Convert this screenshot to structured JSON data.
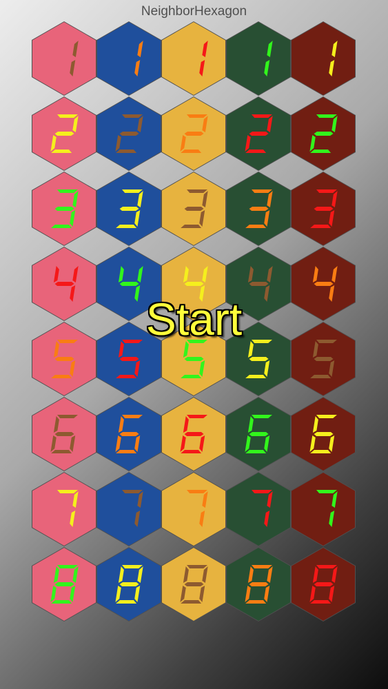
{
  "app": {
    "title": "NeighborHexagon"
  },
  "overlay": {
    "start_label": "Start"
  },
  "colors": {
    "hex_backgrounds": [
      "#e8647a",
      "#1f4f9c",
      "#e7b33f",
      "#284f33",
      "#711e12"
    ],
    "digit_palette": {
      "brown": "#8d5a30",
      "orange": "#f97d13",
      "red": "#f51818",
      "green": "#32f51c",
      "yellow": "#f5ef1d"
    }
  },
  "board": {
    "rows": [
      {
        "digit": "1",
        "cells": [
          {
            "digit_color": "brown"
          },
          {
            "digit_color": "orange"
          },
          {
            "digit_color": "red"
          },
          {
            "digit_color": "green"
          },
          {
            "digit_color": "yellow"
          }
        ]
      },
      {
        "digit": "2",
        "cells": [
          {
            "digit_color": "yellow"
          },
          {
            "digit_color": "brown"
          },
          {
            "digit_color": "orange"
          },
          {
            "digit_color": "red"
          },
          {
            "digit_color": "green"
          }
        ]
      },
      {
        "digit": "3",
        "cells": [
          {
            "digit_color": "green"
          },
          {
            "digit_color": "yellow"
          },
          {
            "digit_color": "brown"
          },
          {
            "digit_color": "orange"
          },
          {
            "digit_color": "red"
          }
        ]
      },
      {
        "digit": "4",
        "cells": [
          {
            "digit_color": "red"
          },
          {
            "digit_color": "green"
          },
          {
            "digit_color": "yellow"
          },
          {
            "digit_color": "brown"
          },
          {
            "digit_color": "orange"
          }
        ]
      },
      {
        "digit": "5",
        "cells": [
          {
            "digit_color": "orange"
          },
          {
            "digit_color": "red"
          },
          {
            "digit_color": "green"
          },
          {
            "digit_color": "yellow"
          },
          {
            "digit_color": "brown"
          }
        ]
      },
      {
        "digit": "6",
        "cells": [
          {
            "digit_color": "brown"
          },
          {
            "digit_color": "orange"
          },
          {
            "digit_color": "red"
          },
          {
            "digit_color": "green"
          },
          {
            "digit_color": "yellow"
          }
        ]
      },
      {
        "digit": "7",
        "cells": [
          {
            "digit_color": "yellow"
          },
          {
            "digit_color": "brown"
          },
          {
            "digit_color": "orange"
          },
          {
            "digit_color": "red"
          },
          {
            "digit_color": "green"
          }
        ]
      },
      {
        "digit": "8",
        "cells": [
          {
            "digit_color": "green"
          },
          {
            "digit_color": "yellow"
          },
          {
            "digit_color": "brown"
          },
          {
            "digit_color": "orange"
          },
          {
            "digit_color": "red"
          }
        ]
      }
    ]
  }
}
